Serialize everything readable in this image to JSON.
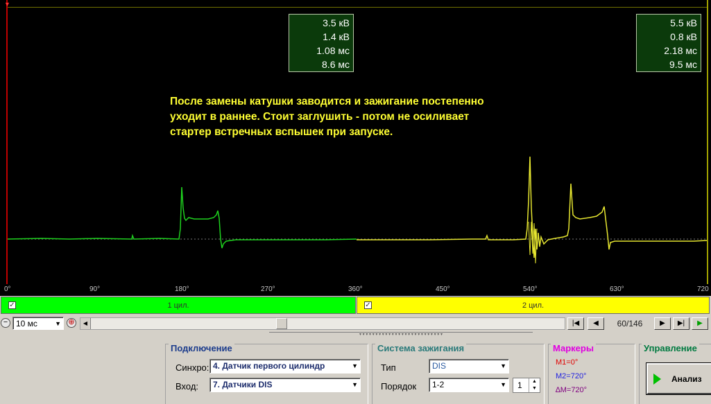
{
  "measurements": {
    "channel1": [
      "3.5 кВ",
      "1.4 кВ",
      "1.08 мс",
      "8.6 мс"
    ],
    "channel2": [
      "5.5 кВ",
      "0.8 кВ",
      "2.18 мс",
      "9.5 мс"
    ]
  },
  "note": {
    "lines": [
      "После замены катушки заводится и зажигание постепенно",
      "уходит в раннее. Стоит заглушить - потом не осиливает",
      "стартер встречных вспышек при запуске."
    ],
    "color": "#ffff33"
  },
  "degree_axis": [
    "0°",
    "90°",
    "180°",
    "270°",
    "360°",
    "450°",
    "540°",
    "630°",
    "720"
  ],
  "channels": [
    {
      "label": "1 цил.",
      "checked": true,
      "color": "#00ff00"
    },
    {
      "label": "2 цил.",
      "checked": true,
      "color": "#ffff00"
    }
  ],
  "timebar": {
    "timebase": "10 мс",
    "frame": "60/146"
  },
  "connection": {
    "title": "Подключение",
    "sync_label": "Синхро:",
    "sync_value": "4.  Датчик первого цилиндр",
    "input_label": "Вход:",
    "input_value": "7.  Датчики DIS"
  },
  "ignition": {
    "title": "Система зажигания",
    "type_label": "Тип",
    "type_value": "DIS",
    "order_label": "Порядок",
    "order_value": "1-2",
    "order_spin": "1"
  },
  "markers": {
    "title": "Маркеры",
    "m1": "M1=0°",
    "m2": "M2=720°",
    "dm": "∆M=720°"
  },
  "control": {
    "title": "Управление",
    "analyze": "Анализ"
  },
  "colors": {
    "green_trace": "#1fd21f",
    "yellow_trace": "#e6e630",
    "marker_m1": "#e00000",
    "marker_m2": "#2020e0",
    "marker_dm": "#800080",
    "group_title_conn": "#1c3c8c",
    "group_title_ign": "#2a7a7a",
    "group_title_mark": "#e000e0",
    "group_title_ctrl": "#007a40"
  }
}
